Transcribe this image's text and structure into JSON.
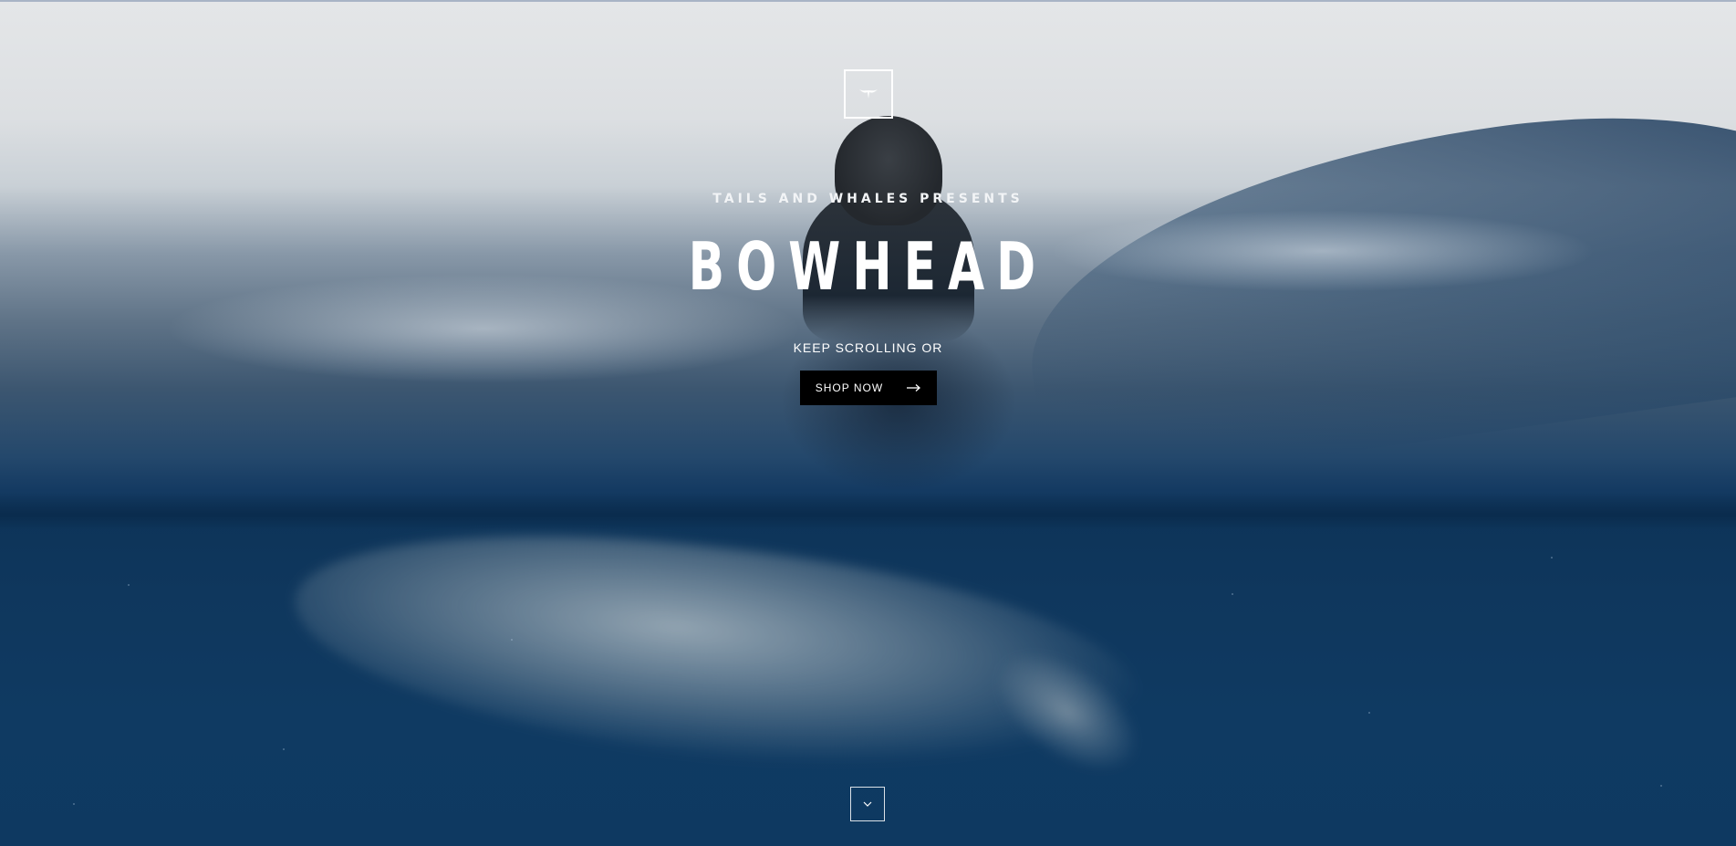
{
  "hero": {
    "presents": "TAILS AND WHALES PRESENTS",
    "brand": "BOWHEAD",
    "tagline": "KEEP SCROLLING OR",
    "shop_button": {
      "label": "SHOP NOW",
      "icon": "arrow-right-icon"
    },
    "scroll_button": {
      "icon": "chevron-down-icon"
    },
    "logo_icon": "whale-tail-icon"
  },
  "colors": {
    "sky": "#e4e6e8",
    "ocean": "#0e3961",
    "button": "#000000",
    "text": "#ffffff"
  }
}
